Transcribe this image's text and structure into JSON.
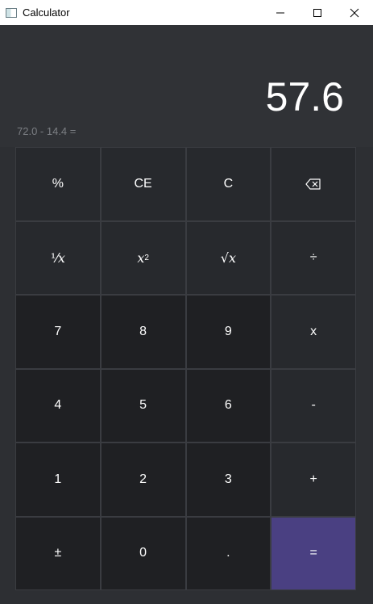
{
  "window": {
    "title": "Calculator"
  },
  "display": {
    "result": "57.6",
    "expression": "72.0 - 14.4 ="
  },
  "keys": {
    "percent": "%",
    "ce": "CE",
    "c": "C",
    "reciprocal_num": "⅟",
    "reciprocal_var": "x",
    "square_var": "x",
    "square_exp": "2",
    "sqrt_symbol": "√",
    "sqrt_var": "x",
    "divide": "÷",
    "seven": "7",
    "eight": "8",
    "nine": "9",
    "multiply": "x",
    "four": "4",
    "five": "5",
    "six": "6",
    "minus": "-",
    "one": "1",
    "two": "2",
    "three": "3",
    "plus": "+",
    "negate": "±",
    "zero": "0",
    "decimal": ".",
    "equals": "="
  },
  "icons": {
    "app": "calculator-icon",
    "minimize": "minimize-icon",
    "maximize": "maximize-icon",
    "close": "close-icon",
    "backspace": "backspace-icon"
  },
  "colors": {
    "equals_accent": "#4a4082",
    "number_key": "#1f2023",
    "operator_key": "#27292d"
  }
}
